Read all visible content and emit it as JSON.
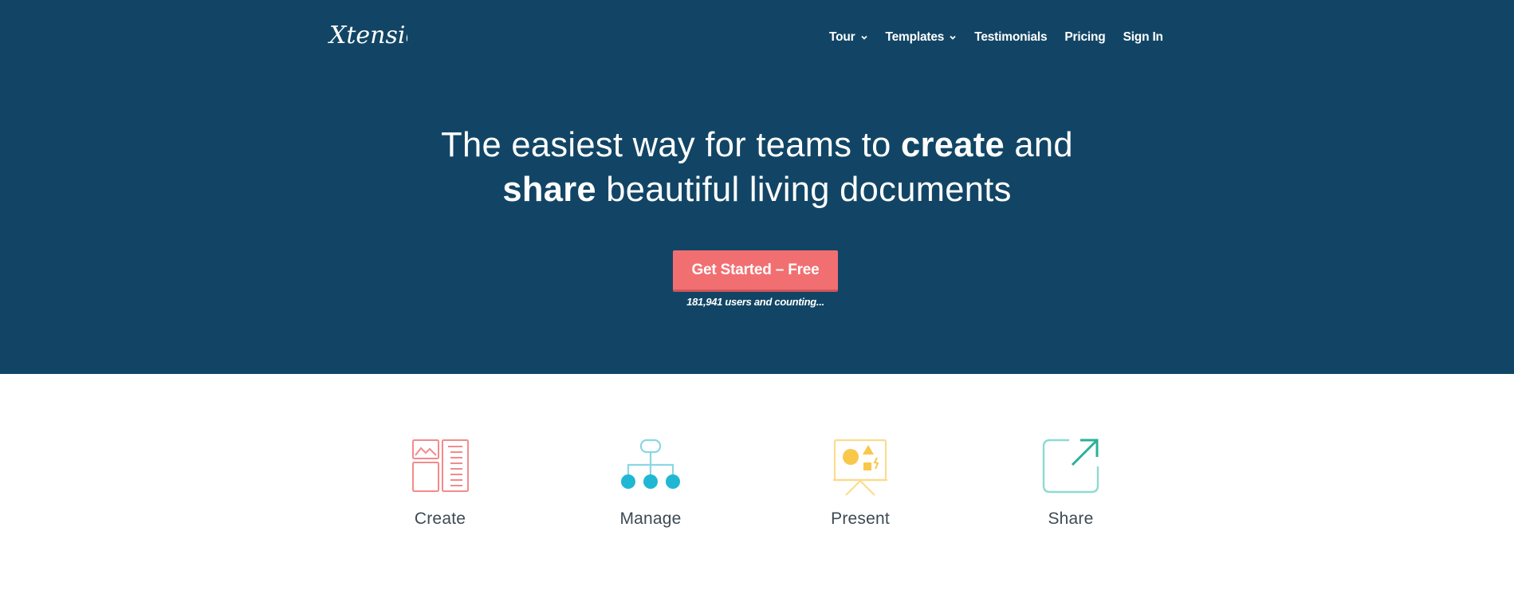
{
  "brand": {
    "logo_text": "Xtensio"
  },
  "nav": {
    "items": [
      {
        "label": "Tour",
        "dropdown": true
      },
      {
        "label": "Templates",
        "dropdown": true
      },
      {
        "label": "Testimonials",
        "dropdown": false
      },
      {
        "label": "Pricing",
        "dropdown": false
      },
      {
        "label": "Sign In",
        "dropdown": false
      }
    ]
  },
  "hero": {
    "headline_line1_a": "The easiest way for teams to ",
    "headline_line1_bold": "create",
    "headline_line1_b": " and",
    "headline_line2_bold": "share",
    "headline_line2_b": " beautiful living documents",
    "cta_label": "Get Started – Free",
    "counter": "181,941 users and counting..."
  },
  "features": [
    {
      "label": "Create",
      "icon": "layout-document-icon",
      "color": "#f28b8c"
    },
    {
      "label": "Manage",
      "icon": "hierarchy-icon",
      "color": "#1fb7d4"
    },
    {
      "label": "Present",
      "icon": "presentation-board-icon",
      "color": "#f9c84a"
    },
    {
      "label": "Share",
      "icon": "share-external-icon",
      "color": "#5ccfc4"
    }
  ],
  "colors": {
    "hero_bg": "#124565",
    "cta_bg": "#f26f71",
    "text_dark": "#3d4a55"
  }
}
